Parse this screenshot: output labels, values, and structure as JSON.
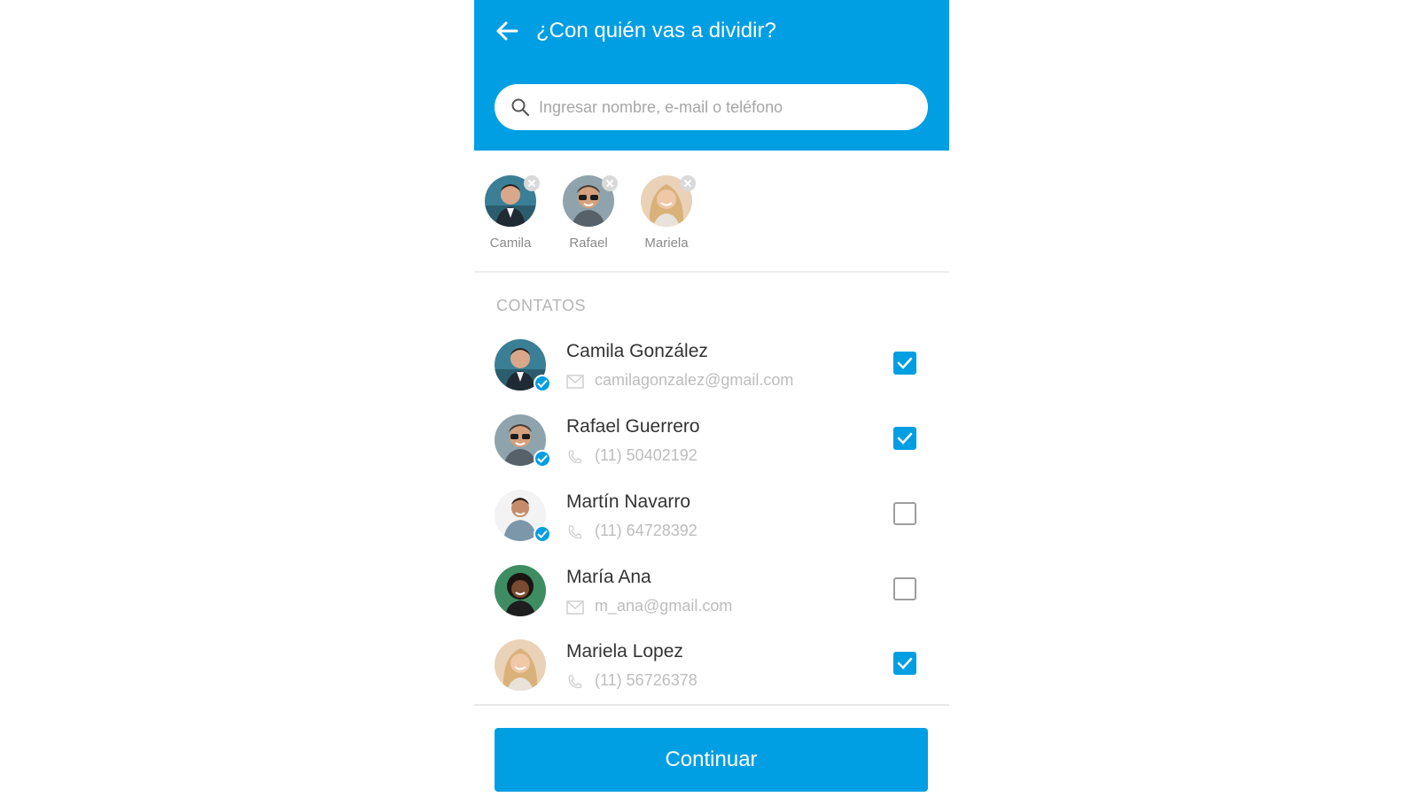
{
  "header": {
    "title": "¿Con quién vas a dividir?",
    "back_icon": "arrow-left-icon"
  },
  "search": {
    "placeholder": "Ingresar nombre, e-mail o teléfono",
    "value": "",
    "icon": "search-icon"
  },
  "selected": [
    {
      "name": "Camila"
    },
    {
      "name": "Rafael"
    },
    {
      "name": "Mariela"
    }
  ],
  "contacts": {
    "section_label": "CONTATOS",
    "items": [
      {
        "name": "Camila González",
        "detail": "camilagonzalez@gmail.com",
        "detail_type": "email",
        "verified": true,
        "checked": true
      },
      {
        "name": "Rafael Guerrero",
        "detail": "(11) 50402192",
        "detail_type": "phone",
        "verified": true,
        "checked": true
      },
      {
        "name": "Martín Navarro",
        "detail": "(11) 64728392",
        "detail_type": "phone",
        "verified": true,
        "checked": false
      },
      {
        "name": "María Ana",
        "detail": "m_ana@gmail.com",
        "detail_type": "email",
        "verified": false,
        "checked": false
      },
      {
        "name": "Mariela Lopez",
        "detail": "(11) 56726378",
        "detail_type": "phone",
        "verified": false,
        "checked": true
      }
    ]
  },
  "cta": {
    "label": "Continuar"
  },
  "colors": {
    "primary": "#009ee3",
    "muted_text": "#bdbdbd",
    "text": "#333333"
  }
}
